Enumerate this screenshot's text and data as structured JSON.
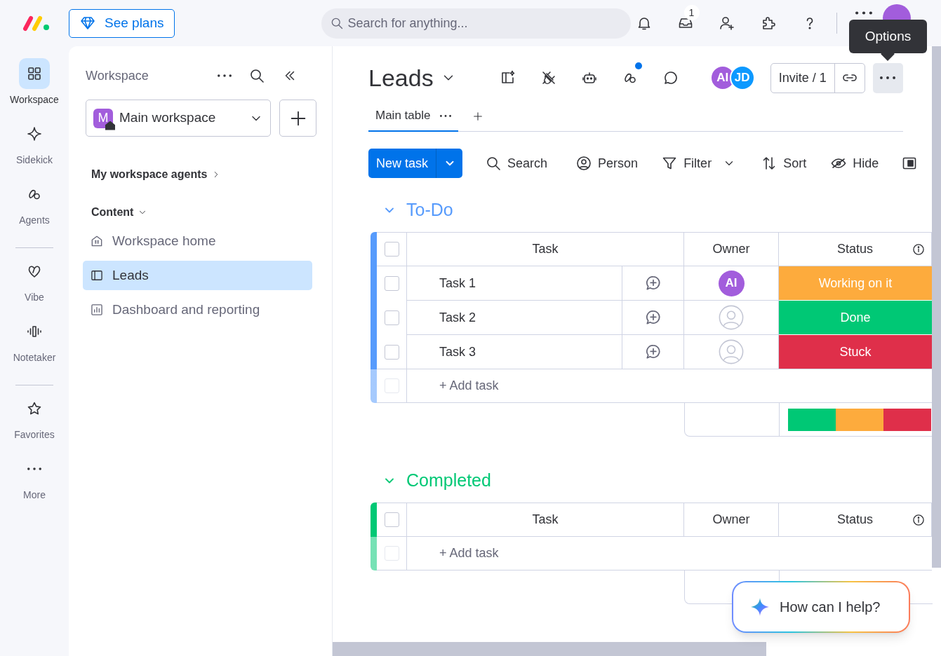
{
  "topbar": {
    "upgrade_button": "See plans",
    "search_placeholder": "Search for anything...",
    "inbox_badge": "1",
    "tooltip": "Options"
  },
  "rail": [
    {
      "label": "Workspace",
      "selected": true
    },
    {
      "label": "Sidekick",
      "selected": false
    },
    {
      "label": "Agents",
      "selected": false
    },
    {
      "label": "Vibe",
      "selected": false
    },
    {
      "label": "Notetaker",
      "selected": false
    },
    {
      "label": "Favorites",
      "selected": false
    },
    {
      "label": "More",
      "selected": false
    }
  ],
  "sidebar": {
    "title": "Workspace",
    "workspace": {
      "initial": "M",
      "name": "Main workspace"
    },
    "agents_link": "My workspace agents",
    "section": {
      "label": "Content",
      "expanded": true
    },
    "items": [
      {
        "label": "Workspace home",
        "selected": false
      },
      {
        "label": "Leads",
        "selected": true
      },
      {
        "label": "Dashboard and reporting",
        "selected": false
      }
    ]
  },
  "board": {
    "title": "Leads",
    "updates_dot": true,
    "members": [
      {
        "initials": "AI",
        "color": "#a25ddc"
      },
      {
        "initials": "JD",
        "color": "#0d99ff"
      }
    ],
    "invite_button": "Invite / 1",
    "tabs": [
      {
        "label": "Main table",
        "selected": true
      }
    ],
    "toolbar": {
      "new_button": "New task",
      "actions": [
        "Search",
        "Person",
        "Filter",
        "Sort",
        "Hide"
      ]
    },
    "groups": [
      {
        "name": "To-Do",
        "color": "#579bfc",
        "expanded": true,
        "columns": [
          "Task",
          "Owner",
          "Status"
        ],
        "rows": [
          {
            "task": "Task 1",
            "checked": false,
            "owner": {
              "kind": "avatar",
              "initials": "AI",
              "color": "#a25ddc"
            },
            "status": {
              "label": "Working on it",
              "color": "#fdab3d"
            }
          },
          {
            "task": "Task 2",
            "checked": false,
            "owner": {
              "kind": "empty"
            },
            "status": {
              "label": "Done",
              "color": "#00c875"
            }
          },
          {
            "task": "Task 3",
            "checked": false,
            "owner": {
              "kind": "empty"
            },
            "status": {
              "label": "Stuck",
              "color": "#df2f4a"
            }
          }
        ],
        "select_all_checked": false,
        "add_label": "+ Add task",
        "add_checkbox_disabled": true,
        "summary": [
          {
            "color": "#00c875"
          },
          {
            "color": "#fdab3d"
          },
          {
            "color": "#df2f4a"
          }
        ]
      },
      {
        "name": "Completed",
        "color": "#00c875",
        "expanded": true,
        "columns": [
          "Task",
          "Owner",
          "Status"
        ],
        "select_all_checked": false,
        "add_label": "+ Add task",
        "add_checkbox_disabled": true
      }
    ]
  },
  "assistant": {
    "prompt": "How can I help?"
  }
}
